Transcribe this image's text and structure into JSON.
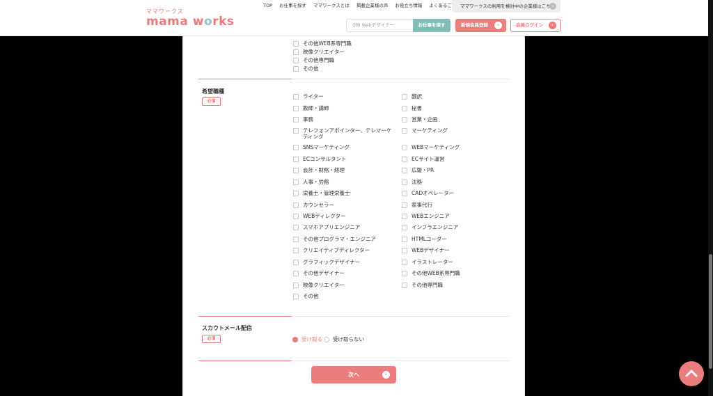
{
  "header": {
    "logo_sub": "ママワークス",
    "logo_main_a": "mama w",
    "logo_main_o": "o",
    "logo_main_b": "rks",
    "nav": [
      "TOP",
      "お仕事を探す",
      "ママワークスとは",
      "掲載企業様の声",
      "お役立ち情報",
      "よくあるご質問"
    ],
    "biz_link": "ママワークスの利用を検討中の企業様はこちら",
    "search_placeholder": "(例) Webデザイナー",
    "search_button": "お仕事を探す",
    "register_button": "新規会員登録",
    "login_button": "会員ログイン"
  },
  "prev_section": {
    "items": [
      "その他WEB系専門職",
      "映像クリエイター",
      "その他専門職",
      "その他"
    ]
  },
  "job_type": {
    "title": "希望職種",
    "required": "必須",
    "left": [
      "ライター",
      "教師・講師",
      "事務",
      "テレフォンアポインター、テレマーケティング",
      "SNSマーケティング",
      "ECコンサルタント",
      "会計・財務・経理",
      "人事・労務",
      "栄養士・管理栄養士",
      "カウンセラー",
      "WEBディレクター",
      "スマホアプリエンジニア",
      "その他プログラマ・エンジニア",
      "クリエイティブディレクター",
      "グラフィックデザイナー",
      "その他デザイナー",
      "映像クリエイター",
      "その他"
    ],
    "right": [
      "翻訳",
      "秘書",
      "営業・企画",
      "マーケティング",
      "WEBマーケティング",
      "ECサイト運営",
      "広報・PR",
      "法務",
      "CADオペレーター",
      "家事代行",
      "WEBエンジニア",
      "インフラエンジニア",
      "HTMLコーダー",
      "WEBデザイナー",
      "イラストレーター",
      "その他WEB系専門職",
      "その他専門職"
    ]
  },
  "scout": {
    "title": "スカウトメール配信",
    "required": "必須",
    "option_yes": "受け取る",
    "option_no": "受け取らない"
  },
  "next_button": "次へ",
  "colors": {
    "accent": "#ec7d7d",
    "teal": "#7fbdb5"
  }
}
